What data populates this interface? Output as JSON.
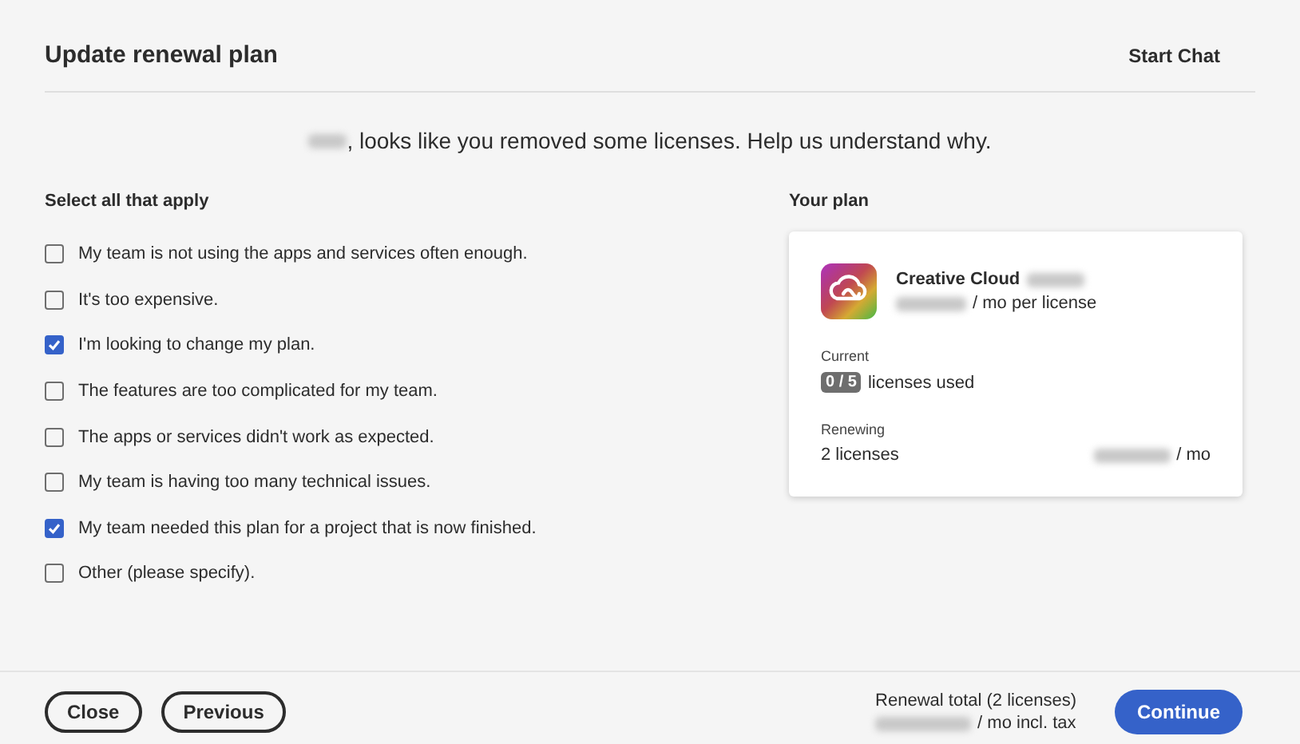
{
  "header": {
    "title": "Update renewal plan",
    "chat_link": "Start Chat"
  },
  "message": ", looks like you removed some licenses. Help us understand why.",
  "reasons": {
    "heading": "Select all that apply",
    "options": [
      {
        "label": "My team is not using the apps and services often enough.",
        "checked": false
      },
      {
        "label": "It's too expensive.",
        "checked": false
      },
      {
        "label": "I'm looking to change my plan.",
        "checked": true
      },
      {
        "label": "The features are too complicated for my team.",
        "checked": false
      },
      {
        "label": "The apps or services didn't work as expected.",
        "checked": false
      },
      {
        "label": "My team is having too many technical issues.",
        "checked": false
      },
      {
        "label": "My team needed this plan for a project that is now finished.",
        "checked": true
      },
      {
        "label": "Other (please specify).",
        "checked": false
      }
    ]
  },
  "plan": {
    "heading": "Your plan",
    "product": "Creative Cloud",
    "price_suffix": "/ mo per license",
    "current_label": "Current",
    "usage_badge": "0 / 5",
    "usage_text": "licenses used",
    "renewing_label": "Renewing",
    "renewing_count": "2 licenses",
    "renewing_suffix": "/ mo"
  },
  "footer": {
    "buttons": [
      "Close",
      "Previous"
    ],
    "total_label": "Renewal total (2 licenses)",
    "total_suffix": "/ mo incl. tax",
    "primary": "Continue"
  }
}
